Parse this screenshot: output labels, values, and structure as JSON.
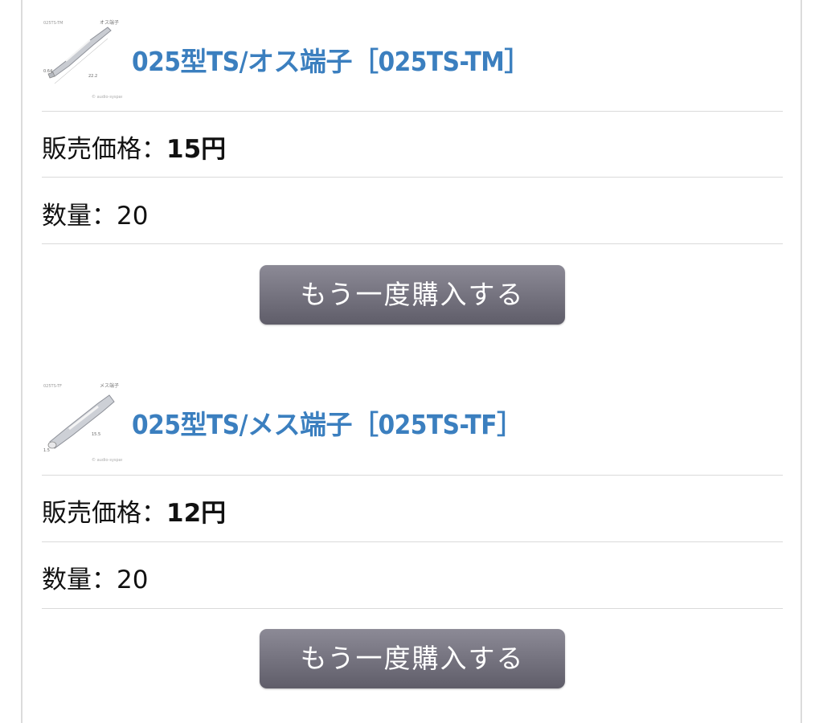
{
  "items": [
    {
      "image_icon": "male-terminal-photo",
      "title": "025型TS/オス端子［025TS-TM］",
      "price_label": "販売価格：",
      "price_value": "15円",
      "qty_label": "数量：",
      "qty_value": "20",
      "rebuy_label": "もう一度購入する"
    },
    {
      "image_icon": "female-terminal-photo",
      "title": "025型TS/メス端子［025TS-TF］",
      "price_label": "販売価格：",
      "price_value": "12円",
      "qty_label": "数量：",
      "qty_value": "20",
      "rebuy_label": "もう一度購入する"
    }
  ],
  "colors": {
    "title": "#3b7fbf",
    "button_top": "#8c8a96",
    "button_bottom": "#5f5d69",
    "divider": "#dadada"
  }
}
